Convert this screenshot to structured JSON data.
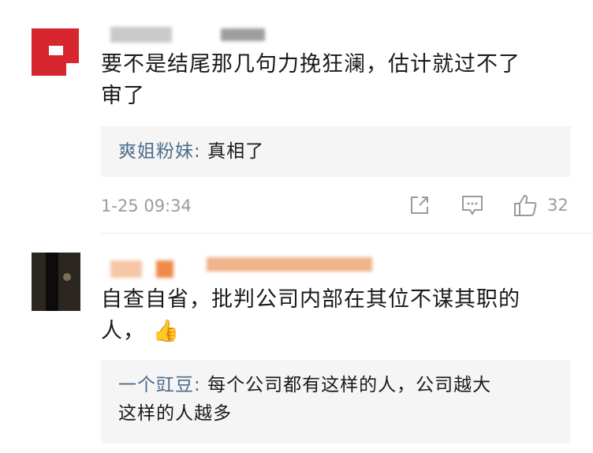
{
  "comments": [
    {
      "text_line1": "要不是结尾那几句力挽狂澜，估计就过不了",
      "text_line2": "审了",
      "reply": {
        "user": "爽姐粉妹",
        "sep": ": ",
        "text": "真相了"
      },
      "time": "1-25 09:34",
      "like_count": "32"
    },
    {
      "text_line1": "自查自省，批判公司内部在其位不谋其职的",
      "text_line2": "人，",
      "emoji": "👍",
      "reply": {
        "user": "一个豇豆",
        "sep": ": ",
        "text_line1": "每个公司都有这样的人，公司越大",
        "text_line2": "这样的人越多"
      }
    }
  ],
  "icons": {
    "share": "share-icon",
    "comment": "comment-icon",
    "like": "thumbs-up-icon"
  },
  "colors": {
    "reply_user": "#4b6d8c",
    "reply_bg": "#f5f5f5",
    "meta": "#9b9b9b",
    "avatar_red": "#d7262e"
  }
}
